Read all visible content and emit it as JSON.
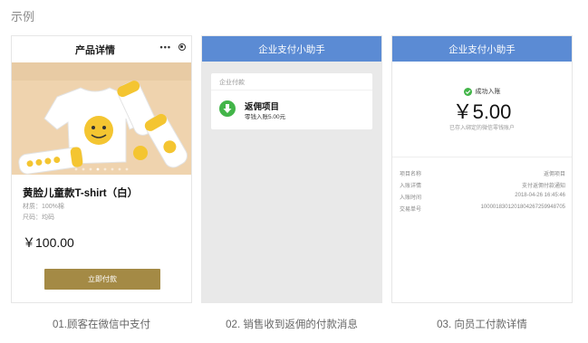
{
  "section_title": "示例",
  "panel1": {
    "header_title": "产品详情",
    "menu_icon": "more-dots-icon",
    "close_icon": "capsule-close-icon",
    "product_name": "黄脸儿童款T-shirt（白）",
    "spec_material": "材质：100%棉",
    "spec_size": "尺码：均码",
    "price": "￥100.00",
    "pay_button": "立即付款",
    "carousel_total": 8,
    "carousel_active": 3,
    "button_color": "#a48a45"
  },
  "panel2": {
    "header_title": "企业支付小助手",
    "card_label": "企业付款",
    "msg_title": "返佣项目",
    "msg_sub": "零钱入账5.00元",
    "header_color": "#5b8bd4",
    "icon_color": "#43b549"
  },
  "panel3": {
    "header_title": "企业支付小助手",
    "status": "成功入账",
    "amount": "￥5.00",
    "amount_note": "已存入绑定的微信零钱账户",
    "details": [
      {
        "key": "项目名称",
        "value": "返佣项目"
      },
      {
        "key": "入账详情",
        "value": "支付返佣付款通知"
      },
      {
        "key": "入账时间",
        "value": "2018-04-26 16:45:46"
      },
      {
        "key": "交易单号",
        "value": "1000018301201804267259948705"
      }
    ]
  },
  "captions": [
    "01.顾客在微信中支付",
    "02. 销售收到返佣的付款消息",
    "03. 向员工付款详情"
  ]
}
